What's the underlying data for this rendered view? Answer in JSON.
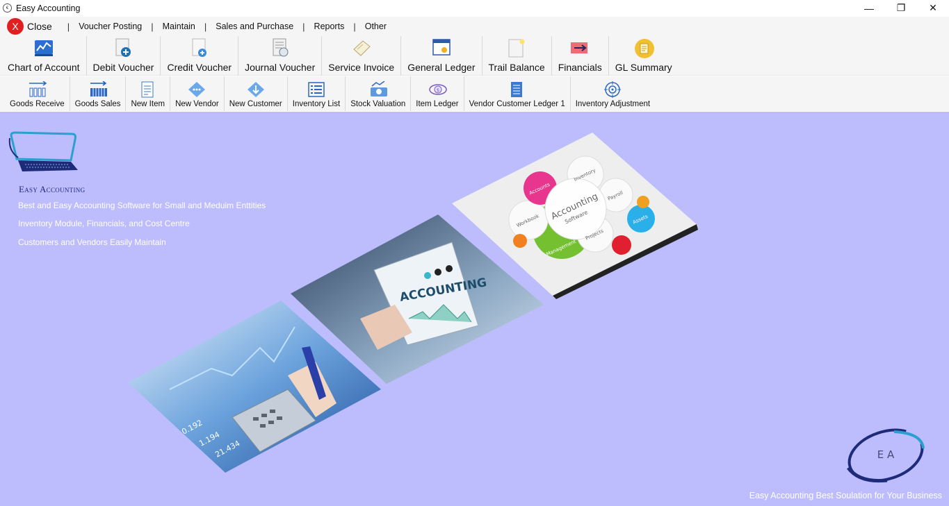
{
  "window": {
    "title": "Easy Accounting",
    "controls": {
      "minimize": "—",
      "restore": "❐",
      "close": "✕"
    }
  },
  "menubar": {
    "close_label": "Close",
    "close_glyph": "X",
    "items": [
      "Voucher Posting",
      "Maintain",
      "Sales and Purchase",
      "Reports",
      "Other"
    ],
    "separator": "|"
  },
  "toolbar_main": [
    {
      "label": "Chart of Account",
      "icon": "chart-of-account-icon"
    },
    {
      "label": "Debit Voucher",
      "icon": "debit-voucher-icon"
    },
    {
      "label": "Credit Voucher",
      "icon": "credit-voucher-icon"
    },
    {
      "label": "Journal Voucher",
      "icon": "journal-voucher-icon"
    },
    {
      "label": "Service Invoice",
      "icon": "service-invoice-icon"
    },
    {
      "label": "General Ledger",
      "icon": "general-ledger-icon"
    },
    {
      "label": "Trail Balance",
      "icon": "trail-balance-icon"
    },
    {
      "label": "Financials",
      "icon": "financials-icon"
    },
    {
      "label": "GL Summary",
      "icon": "gl-summary-icon"
    }
  ],
  "toolbar_secondary": [
    {
      "label": "Goods Receive",
      "icon": "goods-receive-icon"
    },
    {
      "label": "Goods Sales",
      "icon": "goods-sales-icon"
    },
    {
      "label": "New Item",
      "icon": "new-item-icon"
    },
    {
      "label": "New Vendor",
      "icon": "new-vendor-icon"
    },
    {
      "label": "New Customer",
      "icon": "new-customer-icon"
    },
    {
      "label": "Inventory List",
      "icon": "inventory-list-icon"
    },
    {
      "label": "Stock Valuation",
      "icon": "stock-valuation-icon"
    },
    {
      "label": "Item Ledger",
      "icon": "item-ledger-icon"
    },
    {
      "label": "Vendor Customer Ledger 1",
      "icon": "vendor-customer-ledger-icon"
    },
    {
      "label": "Inventory Adjustment",
      "icon": "inventory-adjustment-icon"
    }
  ],
  "main": {
    "brand": "Easy Accounting",
    "taglines": [
      "Best and Easy Accounting Software for Small and Meduim Enttities",
      "Inventory Module, Financials, and Cost Centre",
      "Customers and Vendors Easily Maintain"
    ],
    "ea_logo_text": "E A",
    "footer": "Easy Accounting Best Soulation for Your Business",
    "photos": {
      "center_text": "ACCOUNTING",
      "diagram_center": "Accounting",
      "diagram_center_sub": "Software",
      "diagram_nodes": [
        "Accounts",
        "Inventory",
        "Payroll",
        "Assets",
        "Projects",
        "Management",
        "Workbook"
      ]
    }
  },
  "colors": {
    "main_background": "#bdbdfd",
    "brand_text": "#1d2b78",
    "close_red": "#e02020",
    "chrome": "#f5f5f5"
  }
}
